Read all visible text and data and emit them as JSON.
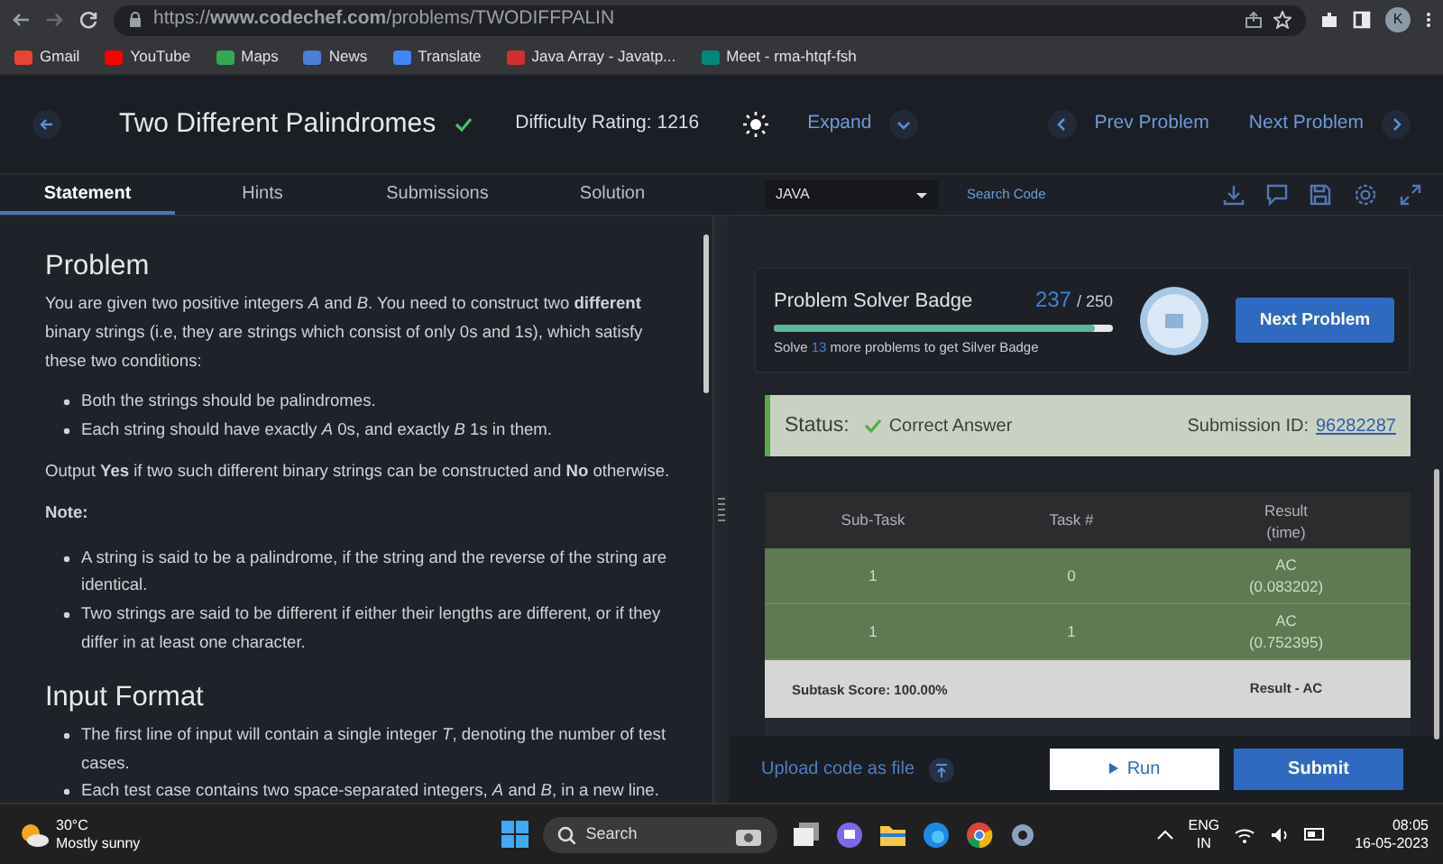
{
  "browser": {
    "url": "https://**www.codechef.com**/problems/TWODIFFPALIN",
    "avatar": "K"
  },
  "bookmarks": [
    "Gmail",
    "YouTube",
    "Maps",
    "News",
    "Translate",
    "Java Array - Javatp...",
    "Meet - rma-htqf-fsh"
  ],
  "header": {
    "title": "Two Different Palindromes",
    "solved": true,
    "difficulty": "Difficulty Rating: 1216",
    "expand": "Expand",
    "prev": "Prev Problem",
    "next": "Next Problem"
  },
  "tabs": [
    {
      "label": "Statement",
      "selected": true
    },
    {
      "label": "Hints",
      "selected": false
    },
    {
      "label": "Submissions",
      "selected": false
    },
    {
      "label": "Solution",
      "selected": false
    }
  ],
  "editor_bar": {
    "language": "JAVA",
    "search_code": "Search Code"
  },
  "statement": [
    {
      "kind": "heading",
      "text": "Problem"
    },
    {
      "kind": "para",
      "text": "You are given two positive integers *A* and *B*. You need to construct two **different** binary strings (i.e, they are strings which consist of only 0s and 1s), which satisfy these two conditions:"
    },
    {
      "kind": "bullets",
      "items": [
        "Both the strings should be palindromes.",
        "Each string should have exactly *A* 0s, and exactly *B* 1s in them."
      ]
    },
    {
      "kind": "para",
      "text": "Output **Yes** if two such different binary strings can be constructed and **No** otherwise."
    },
    {
      "kind": "note",
      "text": "Note:"
    },
    {
      "kind": "bullets",
      "items": [
        "A string is said to be a palindrome, if the string and the reverse of the string are identical.",
        "Two strings are said to be different if either their lengths are different, or if they differ in at least one character."
      ]
    },
    {
      "kind": "heading",
      "text": "Input Format"
    },
    {
      "kind": "bullets",
      "items": [
        "The first line of input will contain a single integer *T*, denoting the number of test cases.",
        "Each test case contains two space-separated integers, *A* and *B*, in a new line."
      ]
    }
  ],
  "badge": {
    "title": "Problem Solver Badge",
    "count": "237",
    "total": "/ 250",
    "level": 0.948,
    "hint_prefix": "Solve",
    "hint_count": "13",
    "hint_suffix": "more problems to get Silver Badge",
    "button": "Next Problem"
  },
  "status": {
    "label": "Status:",
    "result": "Correct Answer",
    "correct": true,
    "id_label": "Submission ID:",
    "id": "96282287"
  },
  "results": {
    "columns": [
      {
        "label": "Sub-Task"
      },
      {
        "label": "Task #"
      },
      {
        "label": "Result",
        "sublabel": "(time)"
      }
    ],
    "rows": [
      {
        "subtask": "1",
        "task": "0",
        "result": "AC",
        "time": "(0.083202)"
      },
      {
        "subtask": "1",
        "task": "1",
        "result": "AC",
        "time": "(0.752395)"
      }
    ],
    "score": "Subtask Score: 100.00%",
    "verdict": "Result - AC"
  },
  "actions": {
    "upload": "Upload code as file",
    "run": "Run",
    "submit": "Submit"
  },
  "taskbar": {
    "temperature": "30°C",
    "weather": "Mostly sunny",
    "search": "Search",
    "language": "ENG",
    "region": "IN",
    "time": "08:05",
    "date": "16-05-2023"
  }
}
